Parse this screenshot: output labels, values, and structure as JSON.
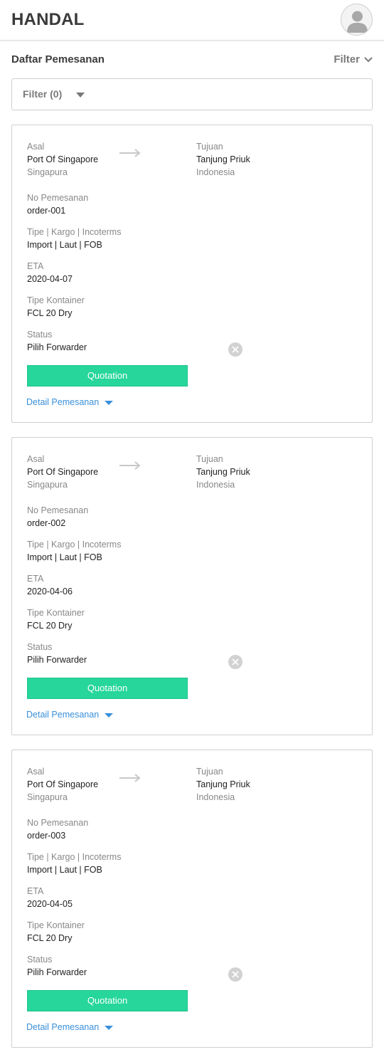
{
  "app": {
    "brand": "HANDAL"
  },
  "header": {
    "title": "Daftar Pemesanan",
    "filter_label": "Filter"
  },
  "filter_box": {
    "label": "Filter (0)"
  },
  "labels": {
    "origin": "Asal",
    "destination": "Tujuan",
    "order_no": "No Pemesanan",
    "type_cargo_incoterms": "Tipe | Kargo | Incoterms",
    "eta": "ETA",
    "container_type": "Tipe Kontainer",
    "status": "Status",
    "quotation_button": "Quotation",
    "detail_link": "Detail Pemesanan"
  },
  "orders": [
    {
      "origin_port": "Port Of Singapore",
      "origin_country": "Singapura",
      "dest_port": "Tanjung Priuk",
      "dest_country": "Indonesia",
      "order_no": "order-001",
      "type_cargo_incoterms": "Import | Laut | FOB",
      "eta": "2020-04-07",
      "container": "FCL 20 Dry",
      "status": "Pilih Forwarder"
    },
    {
      "origin_port": "Port Of Singapore",
      "origin_country": "Singapura",
      "dest_port": "Tanjung Priuk",
      "dest_country": "Indonesia",
      "order_no": "order-002",
      "type_cargo_incoterms": "Import | Laut | FOB",
      "eta": "2020-04-06",
      "container": "FCL 20 Dry",
      "status": "Pilih Forwarder"
    },
    {
      "origin_port": "Port Of Singapore",
      "origin_country": "Singapura",
      "dest_port": "Tanjung Priuk",
      "dest_country": "Indonesia",
      "order_no": "order-003",
      "type_cargo_incoterms": "Import | Laut | FOB",
      "eta": "2020-04-05",
      "container": "FCL 20 Dry",
      "status": "Pilih Forwarder"
    }
  ],
  "colors": {
    "accent_green": "#26d69a",
    "link_blue": "#3a8fd9"
  },
  "icons": [
    "avatar-icon",
    "chevron-down-icon",
    "caret-down-icon",
    "arrow-right-icon",
    "close-icon"
  ]
}
